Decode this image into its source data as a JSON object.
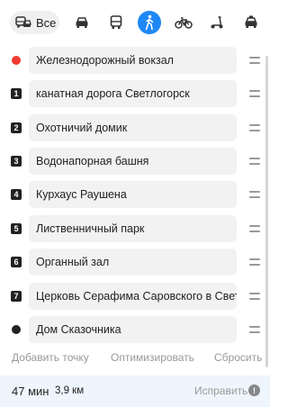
{
  "modes": {
    "all_label": "Все",
    "items": [
      {
        "icon": "bus-car-icon"
      },
      {
        "icon": "car-icon"
      },
      {
        "icon": "bus-icon"
      },
      {
        "icon": "pedestrian-icon",
        "active": true
      },
      {
        "icon": "bicycle-icon"
      },
      {
        "icon": "scooter-icon"
      },
      {
        "icon": "taxi-icon"
      }
    ],
    "active_color": "#1e88f5"
  },
  "route_points": [
    {
      "marker": "",
      "name": "Железнодорожный вокзал"
    },
    {
      "marker": "1",
      "name": "канатная дорога Светлогорск"
    },
    {
      "marker": "2",
      "name": "Охотничий домик"
    },
    {
      "marker": "3",
      "name": "Водонапорная башня"
    },
    {
      "marker": "4",
      "name": "Курхаус Раушена"
    },
    {
      "marker": "5",
      "name": "Лиственничный парк"
    },
    {
      "marker": "6",
      "name": "Органный зал"
    },
    {
      "marker": "7",
      "name": "Церковь Серафима Саровского в Светл..."
    },
    {
      "marker": "",
      "name": "Дом Сказочника"
    }
  ],
  "actions": {
    "add_point": "Добавить точку",
    "optimize": "Оптимизировать",
    "reset": "Сбросить"
  },
  "summary": {
    "time": "47 мин",
    "distance": "3,9 км",
    "fix": "Исправить",
    "info_glyph": "!"
  },
  "colors": {
    "start_dot": "#f33a2e",
    "end_dot": "#222222",
    "summary_bg": "#eef5fd"
  }
}
